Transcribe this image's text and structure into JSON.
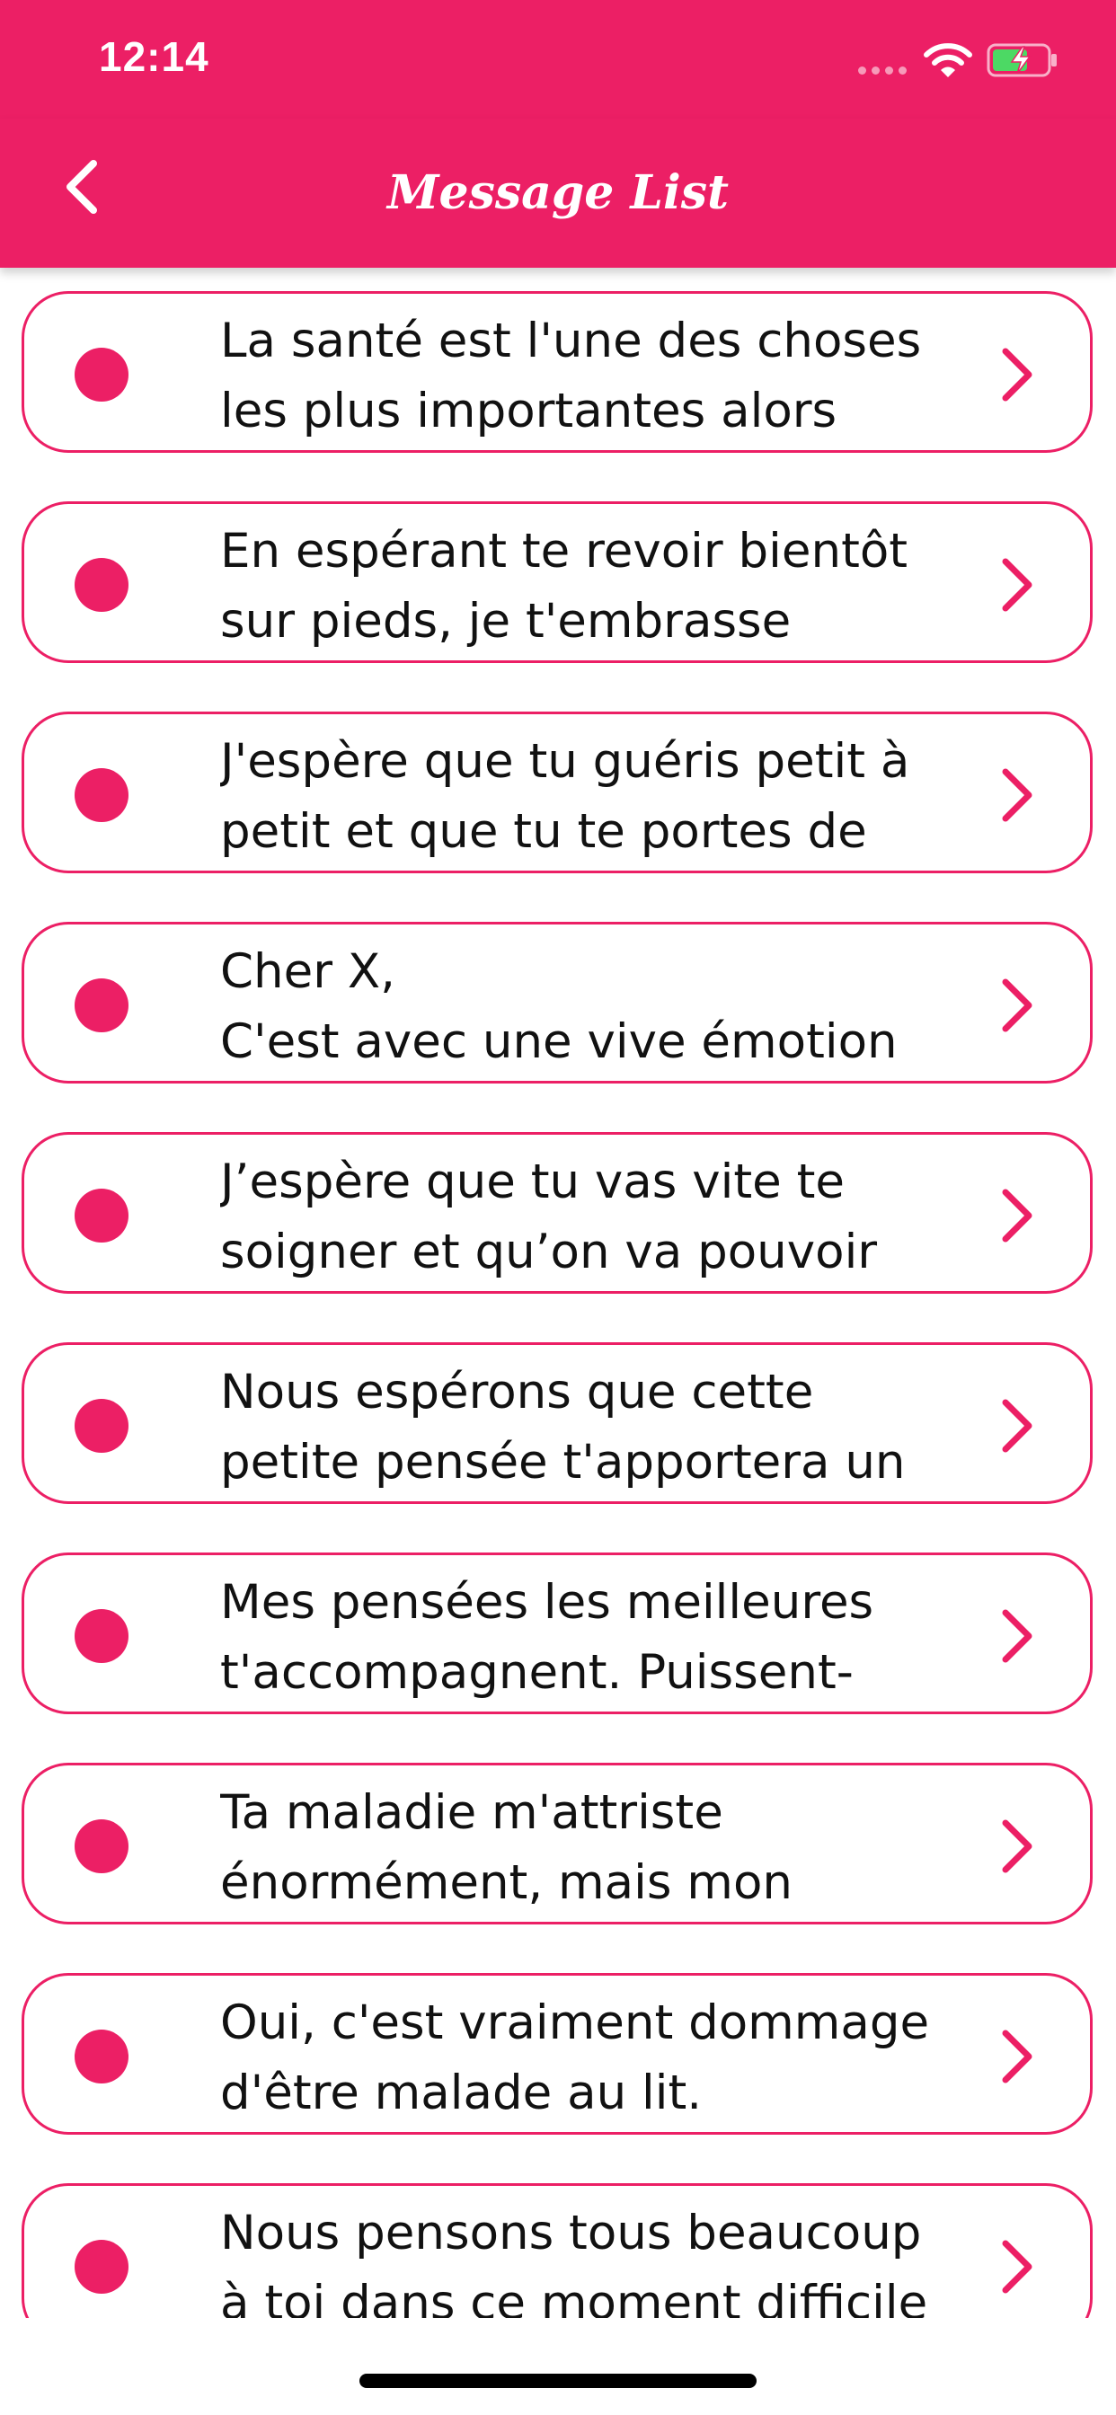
{
  "status_bar": {
    "time": "12:14",
    "icons": [
      "signal-dots-icon",
      "wifi-icon",
      "battery-charging-icon"
    ]
  },
  "nav": {
    "title": "Message List",
    "back_icon": "chevron-left-icon"
  },
  "colors": {
    "accent": "#EC1F65",
    "text": "#111111",
    "background": "#FFFFFF",
    "battery_fill": "#4CD964"
  },
  "messages": [
    {
      "text": "La santé est l'une des choses\nles plus importantes alors"
    },
    {
      "text": "En espérant te revoir bientôt\nsur pieds, je t'embrasse"
    },
    {
      "text": "J'espère que tu guéris petit à\npetit et que tu te portes de"
    },
    {
      "text": "Cher X,\nC'est avec une vive émotion"
    },
    {
      "text": "J’espère que tu vas vite te\nsoigner et qu’on va pouvoir"
    },
    {
      "text": "Nous espérons que cette\npetite pensée t'apportera un"
    },
    {
      "text": "Mes pensées les meilleures\nt'accompagnent. Puissent-"
    },
    {
      "text": "Ta maladie m'attriste\nénormément, mais mon"
    },
    {
      "text": "Oui, c'est vraiment dommage\nd'être malade au lit."
    },
    {
      "text": "Nous pensons tous beaucoup\nà toi dans ce moment difficile"
    }
  ]
}
